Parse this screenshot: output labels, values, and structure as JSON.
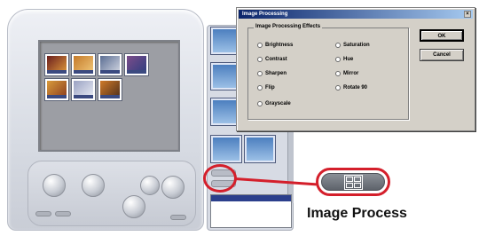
{
  "dialog": {
    "title": "Image Processing",
    "close_glyph": "×",
    "group_title": "Image Processing Effects",
    "options": [
      {
        "label": "Brightness"
      },
      {
        "label": "Contrast"
      },
      {
        "label": "Sharpen"
      },
      {
        "label": "Flip"
      },
      {
        "label": "Grayscale"
      },
      {
        "label": "Saturation"
      },
      {
        "label": "Hue"
      },
      {
        "label": "Mirror"
      },
      {
        "label": "Rotate 90"
      }
    ],
    "ok_label": "OK",
    "cancel_label": "Cancel"
  },
  "callout": {
    "caption": "Image Process",
    "icon": "grid-icon",
    "highlight_color": "#d41f2b"
  }
}
